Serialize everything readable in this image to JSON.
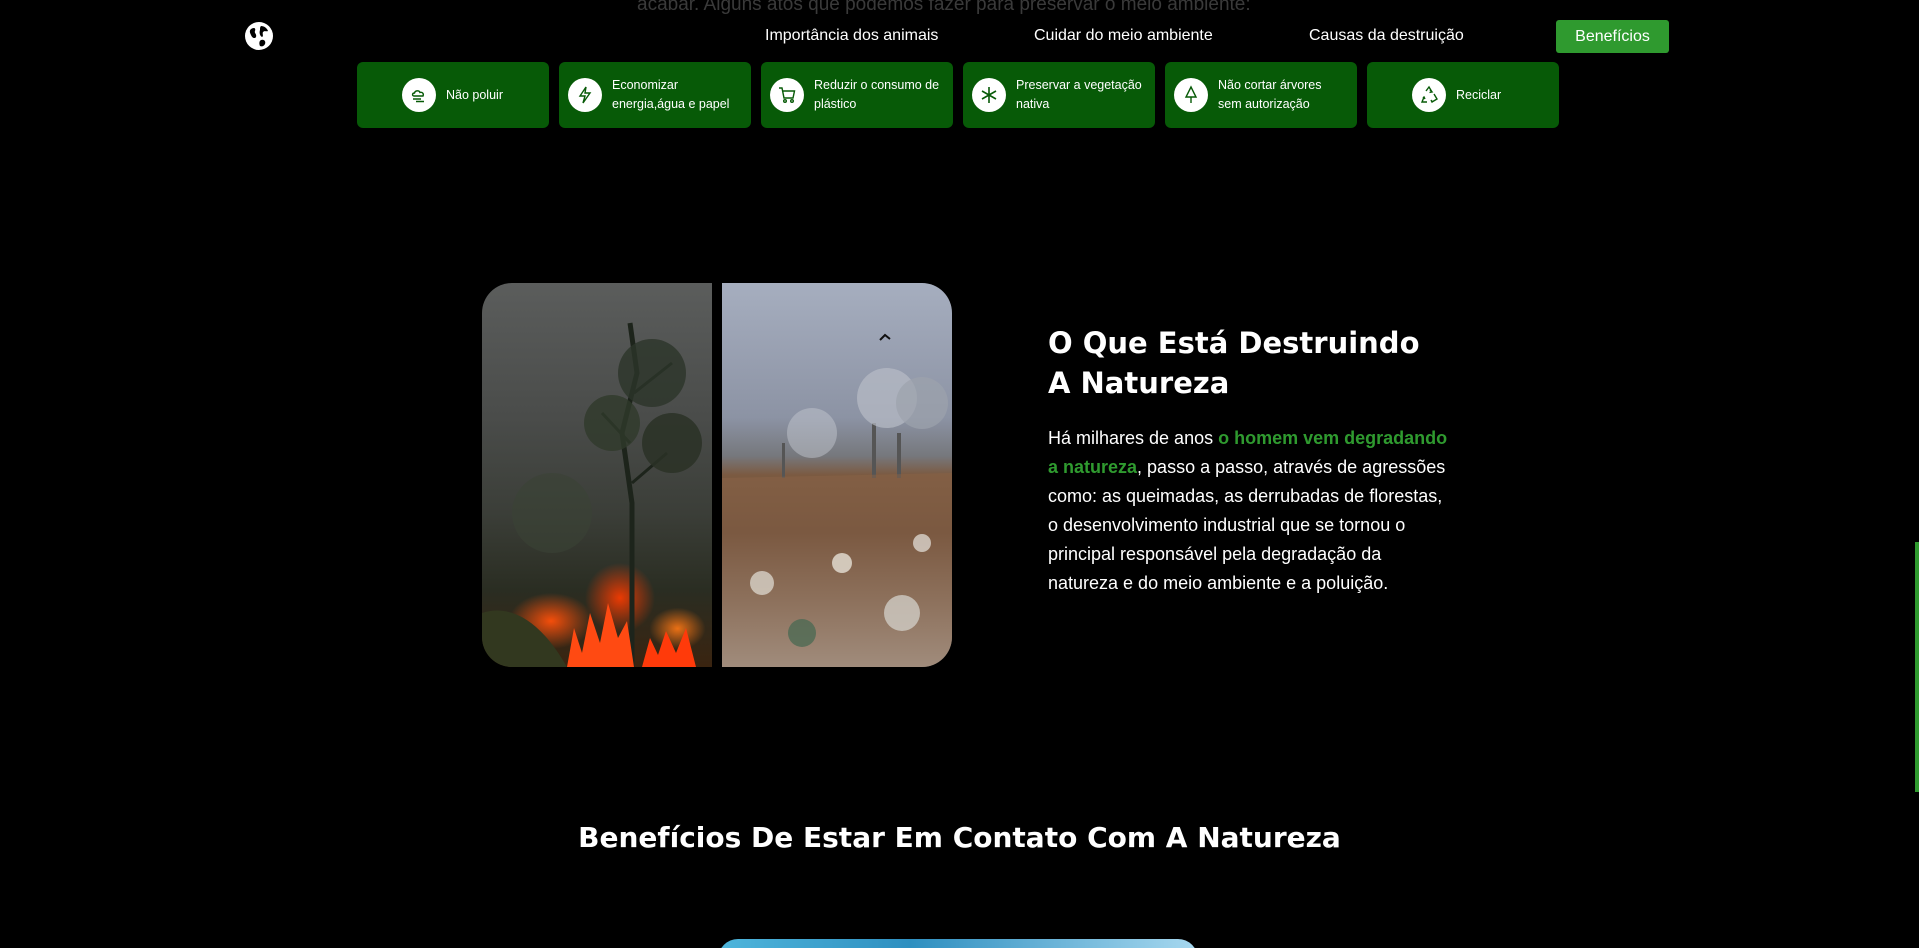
{
  "behind_text": "acabar. Alguns atos que podemos fazer para preservar o meio ambiente:",
  "logo_icon": "globe-icon",
  "nav": {
    "items": [
      {
        "label": "Importância dos animais"
      },
      {
        "label": "Cuidar do meio ambiente"
      },
      {
        "label": "Causas da destruição"
      }
    ],
    "button_label": "Benefícios",
    "button_color": "#2f9a2f"
  },
  "tiles": [
    {
      "label": "Não poluir",
      "icon": "cloud-icon"
    },
    {
      "label": "Economizar energia,água e papel",
      "icon": "lightning-icon"
    },
    {
      "label": "Reduzir o consumo de plástico",
      "icon": "cart-icon"
    },
    {
      "label": "Preservar a vegetação nativa",
      "icon": "snowflake-icon"
    },
    {
      "label": "Não cortar árvores sem autorização",
      "icon": "tree-icon"
    },
    {
      "label": "Reciclar",
      "icon": "recycle-icon"
    }
  ],
  "section": {
    "title": "O Que Está Destruindo A Natureza",
    "text_before": "Há milhares de anos ",
    "highlight": "o homem vem degradando a natureza",
    "text_after": ", passo a passo, através de agressões como: as queimadas, as derrubadas de florestas, o desenvolvimento industrial que se tornou o principal responsável pela degradação da natureza e do meio ambiente e a poluição.",
    "highlight_color": "#2f9a2f"
  },
  "benefits_title": "Benefícios De Estar Em Contato Com A Natureza",
  "colors": {
    "background": "#000000",
    "tile_bg": "#075a07",
    "accent": "#2f9a2f"
  }
}
